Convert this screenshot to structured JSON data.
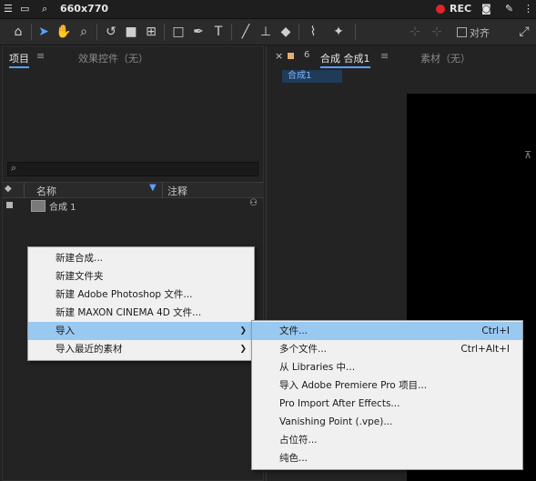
{
  "recorder": {
    "size_label": "660x770",
    "rec_label": "REC"
  },
  "toolbar": {
    "snap_label": "对齐"
  },
  "project_panel": {
    "tab_project": "项目",
    "tab_effects": "效果控件（无）",
    "search_icon_glyph": "⌕",
    "col_name": "名称",
    "col_comment": "注释",
    "items": [
      {
        "name": "合成 1"
      }
    ]
  },
  "comp_panel": {
    "tab_label": "合成 合成1",
    "footage_tab": "素材（无）",
    "comp_chip": "合成1"
  },
  "context_menu": {
    "items": [
      {
        "label": "新建合成..."
      },
      {
        "label": "新建文件夹"
      },
      {
        "label": "新建 Adobe Photoshop 文件..."
      },
      {
        "label": "新建 MAXON CINEMA 4D 文件..."
      },
      {
        "label": "导入",
        "highlighted": true,
        "submenu": true
      },
      {
        "label": "导入最近的素材",
        "submenu": true
      }
    ]
  },
  "import_submenu": {
    "items": [
      {
        "label": "文件...",
        "shortcut": "Ctrl+I",
        "highlighted": true
      },
      {
        "label": "多个文件...",
        "shortcut": "Ctrl+Alt+I"
      },
      {
        "label": "从 Libraries 中..."
      },
      {
        "label": "导入 Adobe Premiere Pro 项目..."
      },
      {
        "label": "Pro Import After Effects..."
      },
      {
        "label": "Vanishing Point (.vpe)..."
      },
      {
        "label": "占位符..."
      },
      {
        "label": "纯色..."
      }
    ]
  },
  "colors": {
    "accent_blue": "#5aa0ff",
    "highlight": "#99c9f0",
    "rec_red": "#e0262a"
  }
}
